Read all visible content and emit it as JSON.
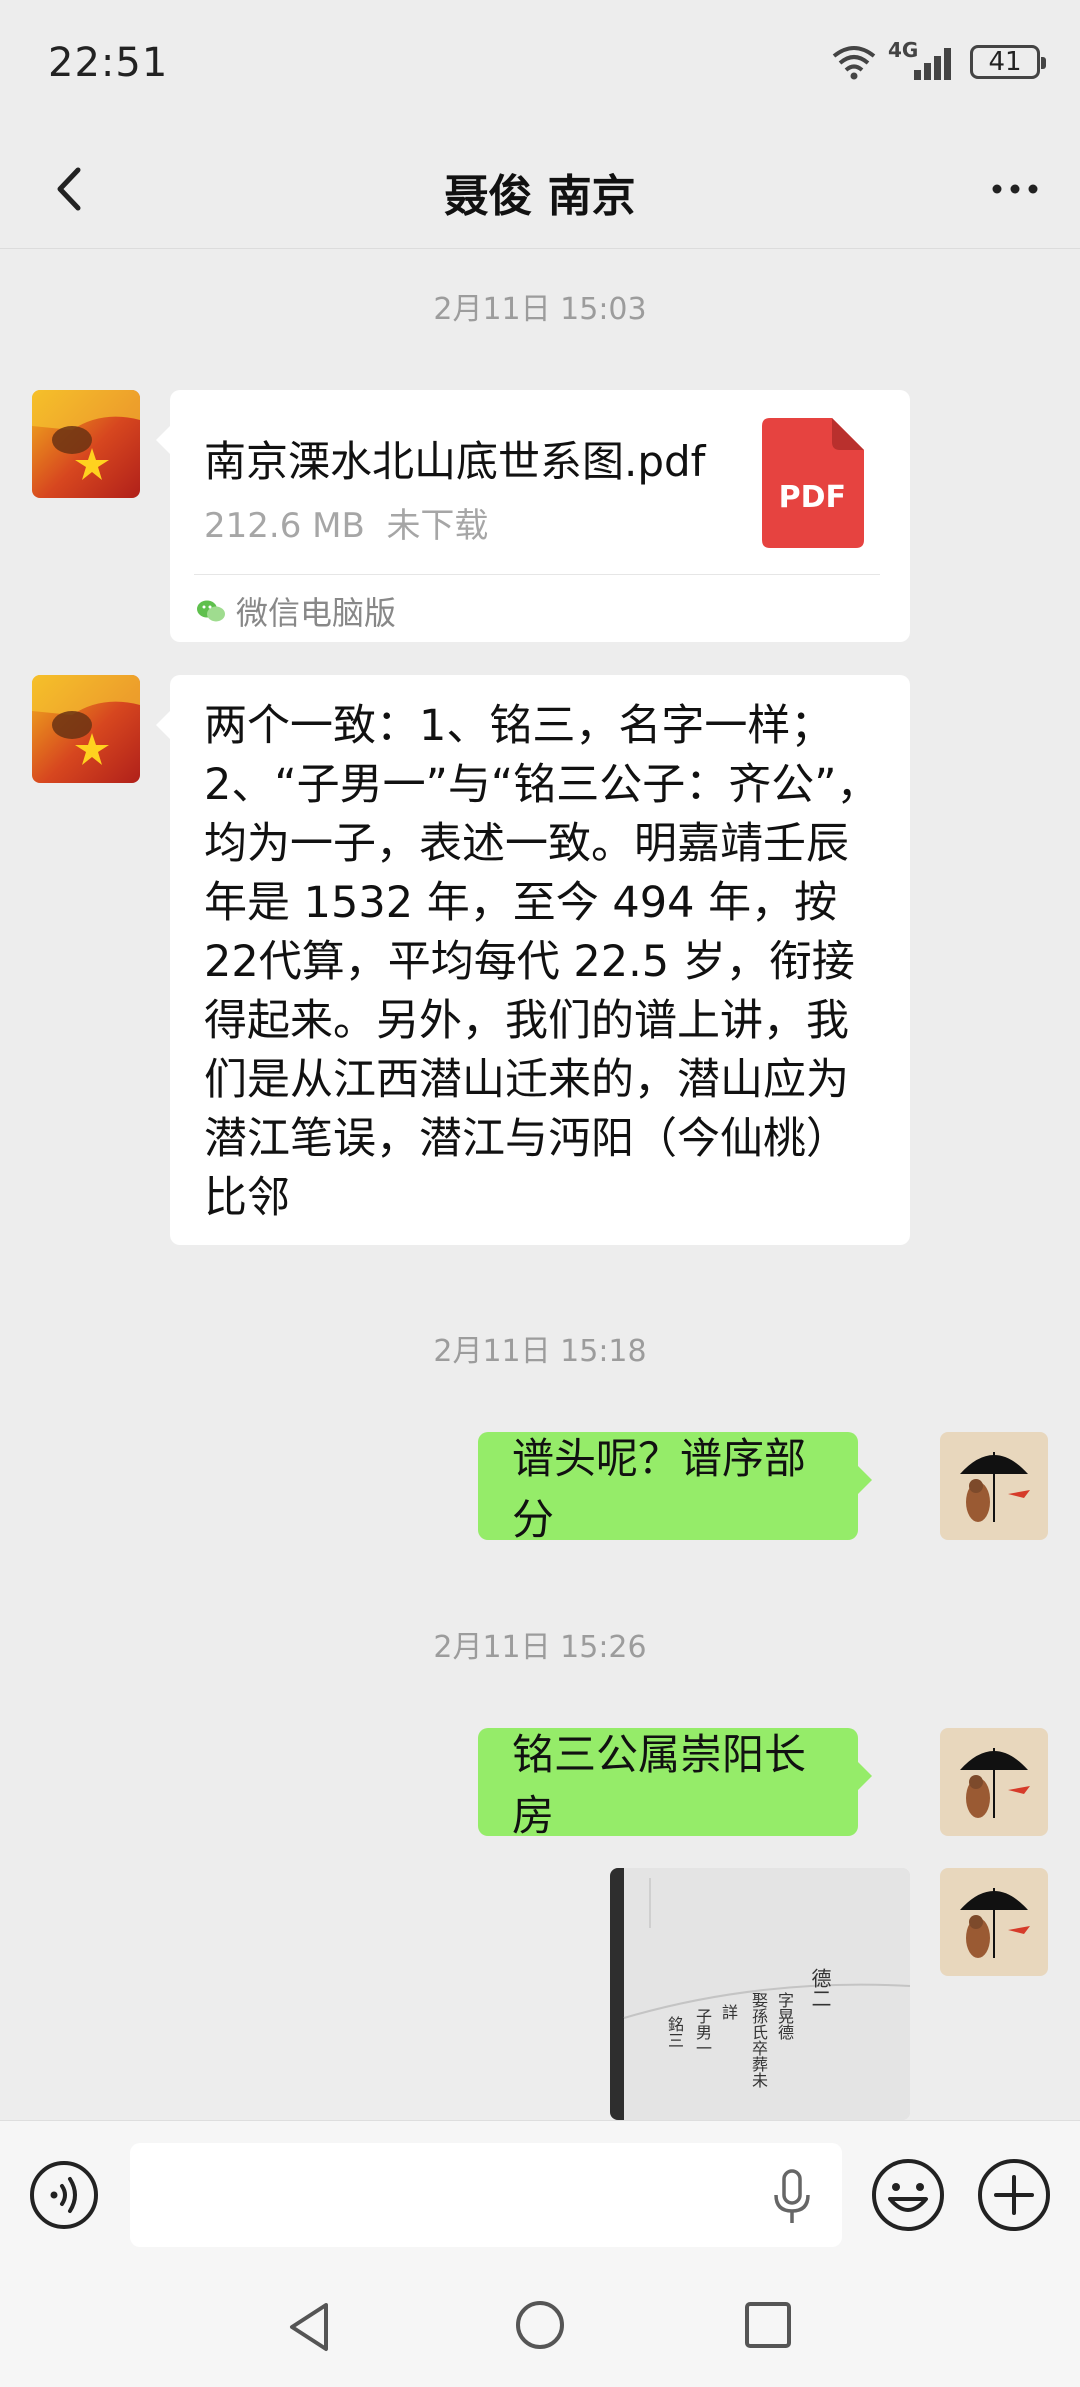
{
  "status_bar": {
    "time": "22:51",
    "network": "4G",
    "battery": "41"
  },
  "nav": {
    "title": "聂俊 南京"
  },
  "messages": {
    "ts1": "2月11日 15:03",
    "file": {
      "name": "南京溧水北山底世系图.pdf",
      "size": "212.6 MB",
      "status": "未下载",
      "badge": "PDF",
      "source": "微信电脑版"
    },
    "text1": "两个一致：1、铭三，名字一样；2、“子男一”与“铭三公子：齐公”，均为一子，表述一致。明嘉靖壬辰年是 1532 年，至今 494 年，按 22代算，平均每代 22.5 岁，衔接得起来。另外，我们的谱上讲，我们是从江西潜山迁来的，潜山应为潜江笔误，潜江与沔阳（今仙桃）比邻",
    "ts2": "2月11日 15:18",
    "out1": "谱头呢？谱序部分",
    "ts3": "2月11日 15:26",
    "out2": "铭三公属崇阳长房",
    "photo_text": [
      "德二",
      "字晃德",
      "娶孫氏卒葬未",
      "詳",
      "子男一",
      "銘三"
    ]
  },
  "input": {
    "placeholder": ""
  },
  "colors": {
    "background": "#ededed",
    "bubble_out": "#95ec69",
    "bubble_in": "#ffffff",
    "pdf_red": "#e64340"
  }
}
